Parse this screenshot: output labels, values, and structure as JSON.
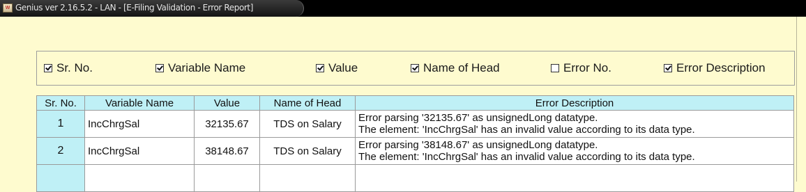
{
  "window": {
    "title": "Genius ver 2.16.5.2 - LAN - [E-Filing Validation - Error Report]",
    "icon": "app-icon"
  },
  "columns_toggle": [
    {
      "label": "Sr. No.",
      "checked": true
    },
    {
      "label": "Variable Name",
      "checked": true
    },
    {
      "label": "Value",
      "checked": true
    },
    {
      "label": "Name of Head",
      "checked": true
    },
    {
      "label": "Error No.",
      "checked": false
    },
    {
      "label": "Error Description",
      "checked": true
    }
  ],
  "table": {
    "headers": [
      "Sr. No.",
      "Variable Name",
      "Value",
      "Name of Head",
      "Error Description"
    ],
    "rows": [
      {
        "sr": "1",
        "variable": "IncChrgSal",
        "value": "32135.67",
        "head": "TDS on Salary",
        "desc1": "Error parsing '32135.67' as unsignedLong datatype.",
        "desc2": "The element: 'IncChrgSal'  has an invalid value according to its data type."
      },
      {
        "sr": "2",
        "variable": "IncChrgSal",
        "value": "38148.67",
        "head": "TDS on Salary",
        "desc1": "Error parsing '38148.67' as unsignedLong datatype.",
        "desc2": "The element: 'IncChrgSal'  has an invalid value according to its data type."
      }
    ]
  },
  "colors": {
    "background": "#fefbcf",
    "header_bg": "#bff0f6",
    "titlebar": "#000000"
  }
}
